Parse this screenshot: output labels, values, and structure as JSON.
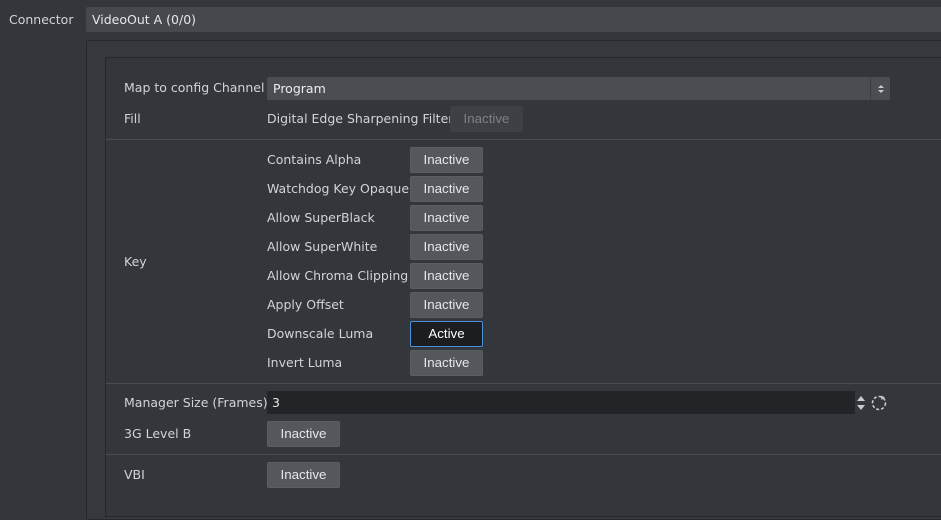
{
  "connector": {
    "label": "Connector",
    "value": "VideoOut A (0/0)"
  },
  "map_channel": {
    "label": "Map to config Channel",
    "value": "Program"
  },
  "fill": {
    "label": "Fill",
    "sharpening_label": "Digital Edge Sharpening Filter",
    "sharpening_state": "Inactive"
  },
  "key": {
    "label": "Key",
    "items": [
      {
        "label": "Contains Alpha",
        "state": "Inactive"
      },
      {
        "label": "Watchdog Key Opaque",
        "state": "Inactive"
      },
      {
        "label": "Allow SuperBlack",
        "state": "Inactive"
      },
      {
        "label": "Allow SuperWhite",
        "state": "Inactive"
      },
      {
        "label": "Allow Chroma Clipping",
        "state": "Inactive"
      },
      {
        "label": "Apply Offset",
        "state": "Inactive"
      },
      {
        "label": "Downscale Luma",
        "state": "Active"
      },
      {
        "label": "Invert Luma",
        "state": "Inactive"
      }
    ]
  },
  "manager_size": {
    "label": "Manager Size (Frames)",
    "value": "3"
  },
  "level_b": {
    "label": "3G Level B",
    "state": "Inactive"
  },
  "vbi": {
    "label": "VBI",
    "state": "Inactive"
  },
  "colors": {
    "accent": "#4d8fd6",
    "background": "#33363b",
    "button": "#54575c"
  },
  "icons": {
    "select_arrows": "up-down-arrows-icon",
    "spin_arrows": "up-down-arrows-icon",
    "reset": "reset-icon"
  }
}
